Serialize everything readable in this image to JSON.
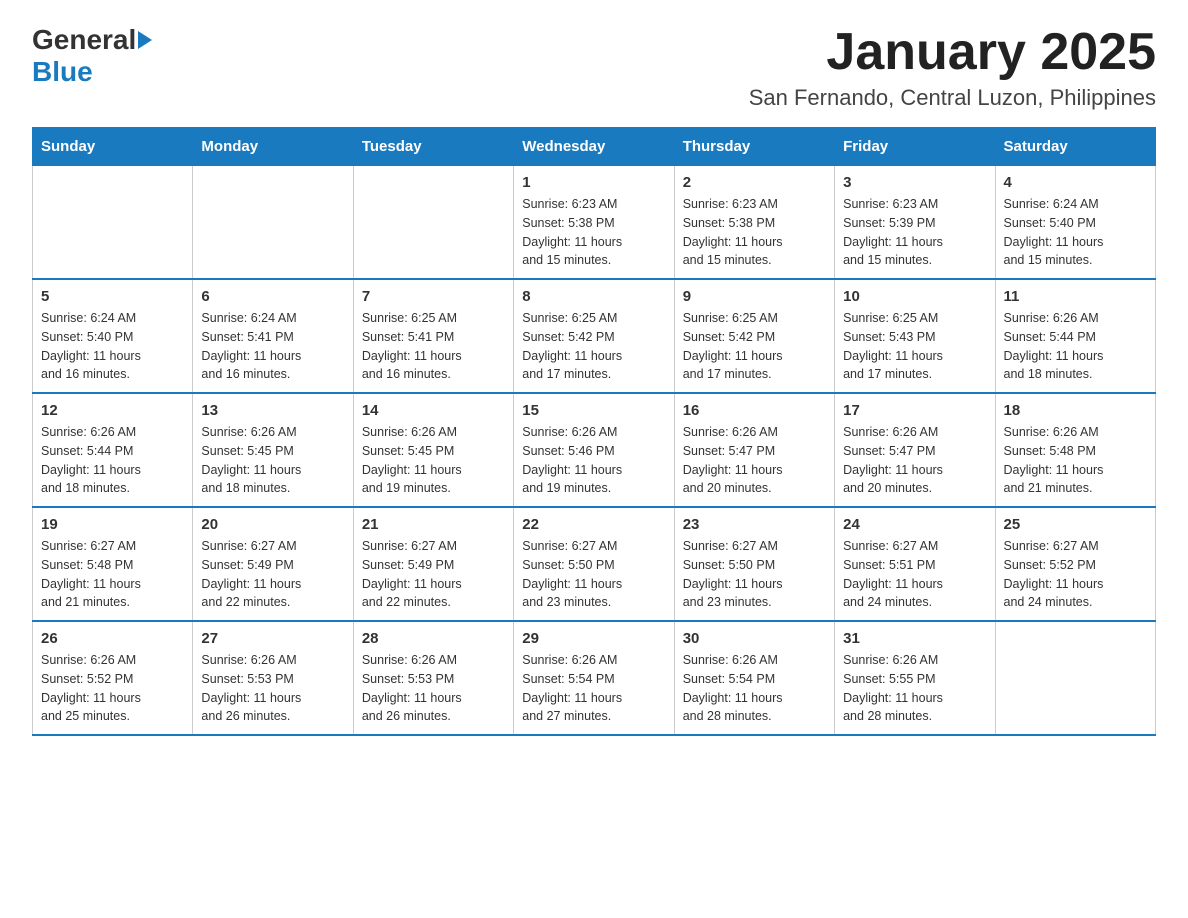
{
  "header": {
    "title": "January 2025",
    "subtitle": "San Fernando, Central Luzon, Philippines"
  },
  "logo": {
    "line1": "General",
    "line2": "Blue"
  },
  "days_of_week": [
    "Sunday",
    "Monday",
    "Tuesday",
    "Wednesday",
    "Thursday",
    "Friday",
    "Saturday"
  ],
  "weeks": [
    [
      {
        "day": "",
        "info": ""
      },
      {
        "day": "",
        "info": ""
      },
      {
        "day": "",
        "info": ""
      },
      {
        "day": "1",
        "info": "Sunrise: 6:23 AM\nSunset: 5:38 PM\nDaylight: 11 hours\nand 15 minutes."
      },
      {
        "day": "2",
        "info": "Sunrise: 6:23 AM\nSunset: 5:38 PM\nDaylight: 11 hours\nand 15 minutes."
      },
      {
        "day": "3",
        "info": "Sunrise: 6:23 AM\nSunset: 5:39 PM\nDaylight: 11 hours\nand 15 minutes."
      },
      {
        "day": "4",
        "info": "Sunrise: 6:24 AM\nSunset: 5:40 PM\nDaylight: 11 hours\nand 15 minutes."
      }
    ],
    [
      {
        "day": "5",
        "info": "Sunrise: 6:24 AM\nSunset: 5:40 PM\nDaylight: 11 hours\nand 16 minutes."
      },
      {
        "day": "6",
        "info": "Sunrise: 6:24 AM\nSunset: 5:41 PM\nDaylight: 11 hours\nand 16 minutes."
      },
      {
        "day": "7",
        "info": "Sunrise: 6:25 AM\nSunset: 5:41 PM\nDaylight: 11 hours\nand 16 minutes."
      },
      {
        "day": "8",
        "info": "Sunrise: 6:25 AM\nSunset: 5:42 PM\nDaylight: 11 hours\nand 17 minutes."
      },
      {
        "day": "9",
        "info": "Sunrise: 6:25 AM\nSunset: 5:42 PM\nDaylight: 11 hours\nand 17 minutes."
      },
      {
        "day": "10",
        "info": "Sunrise: 6:25 AM\nSunset: 5:43 PM\nDaylight: 11 hours\nand 17 minutes."
      },
      {
        "day": "11",
        "info": "Sunrise: 6:26 AM\nSunset: 5:44 PM\nDaylight: 11 hours\nand 18 minutes."
      }
    ],
    [
      {
        "day": "12",
        "info": "Sunrise: 6:26 AM\nSunset: 5:44 PM\nDaylight: 11 hours\nand 18 minutes."
      },
      {
        "day": "13",
        "info": "Sunrise: 6:26 AM\nSunset: 5:45 PM\nDaylight: 11 hours\nand 18 minutes."
      },
      {
        "day": "14",
        "info": "Sunrise: 6:26 AM\nSunset: 5:45 PM\nDaylight: 11 hours\nand 19 minutes."
      },
      {
        "day": "15",
        "info": "Sunrise: 6:26 AM\nSunset: 5:46 PM\nDaylight: 11 hours\nand 19 minutes."
      },
      {
        "day": "16",
        "info": "Sunrise: 6:26 AM\nSunset: 5:47 PM\nDaylight: 11 hours\nand 20 minutes."
      },
      {
        "day": "17",
        "info": "Sunrise: 6:26 AM\nSunset: 5:47 PM\nDaylight: 11 hours\nand 20 minutes."
      },
      {
        "day": "18",
        "info": "Sunrise: 6:26 AM\nSunset: 5:48 PM\nDaylight: 11 hours\nand 21 minutes."
      }
    ],
    [
      {
        "day": "19",
        "info": "Sunrise: 6:27 AM\nSunset: 5:48 PM\nDaylight: 11 hours\nand 21 minutes."
      },
      {
        "day": "20",
        "info": "Sunrise: 6:27 AM\nSunset: 5:49 PM\nDaylight: 11 hours\nand 22 minutes."
      },
      {
        "day": "21",
        "info": "Sunrise: 6:27 AM\nSunset: 5:49 PM\nDaylight: 11 hours\nand 22 minutes."
      },
      {
        "day": "22",
        "info": "Sunrise: 6:27 AM\nSunset: 5:50 PM\nDaylight: 11 hours\nand 23 minutes."
      },
      {
        "day": "23",
        "info": "Sunrise: 6:27 AM\nSunset: 5:50 PM\nDaylight: 11 hours\nand 23 minutes."
      },
      {
        "day": "24",
        "info": "Sunrise: 6:27 AM\nSunset: 5:51 PM\nDaylight: 11 hours\nand 24 minutes."
      },
      {
        "day": "25",
        "info": "Sunrise: 6:27 AM\nSunset: 5:52 PM\nDaylight: 11 hours\nand 24 minutes."
      }
    ],
    [
      {
        "day": "26",
        "info": "Sunrise: 6:26 AM\nSunset: 5:52 PM\nDaylight: 11 hours\nand 25 minutes."
      },
      {
        "day": "27",
        "info": "Sunrise: 6:26 AM\nSunset: 5:53 PM\nDaylight: 11 hours\nand 26 minutes."
      },
      {
        "day": "28",
        "info": "Sunrise: 6:26 AM\nSunset: 5:53 PM\nDaylight: 11 hours\nand 26 minutes."
      },
      {
        "day": "29",
        "info": "Sunrise: 6:26 AM\nSunset: 5:54 PM\nDaylight: 11 hours\nand 27 minutes."
      },
      {
        "day": "30",
        "info": "Sunrise: 6:26 AM\nSunset: 5:54 PM\nDaylight: 11 hours\nand 28 minutes."
      },
      {
        "day": "31",
        "info": "Sunrise: 6:26 AM\nSunset: 5:55 PM\nDaylight: 11 hours\nand 28 minutes."
      },
      {
        "day": "",
        "info": ""
      }
    ]
  ]
}
